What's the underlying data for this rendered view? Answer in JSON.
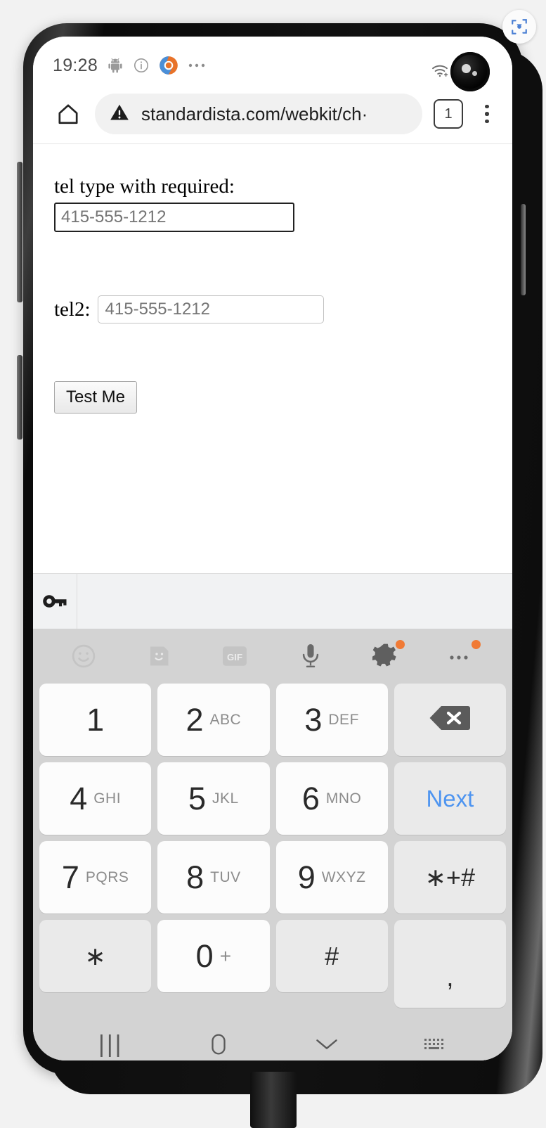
{
  "device": {
    "screenshot_badge_icon": "screenshot-scan-icon"
  },
  "status_bar": {
    "clock": "19:28",
    "left_icons": [
      "android-icon",
      "info-icon",
      "chrome-icon",
      "more-notifications-icon"
    ],
    "right_icons": [
      "wifi-icon",
      "signal-icon",
      "battery-icon"
    ],
    "camera": "front-camera-cutout"
  },
  "browser": {
    "home_icon": "home-icon",
    "security_icon": "warning-triangle-icon",
    "url": "standardista.com/webkit/ch·",
    "tab_count": "1",
    "menu_icon": "overflow-menu-icon"
  },
  "page": {
    "tel1": {
      "label": "tel type with required:",
      "value": "",
      "placeholder": "415-555-1212"
    },
    "tel2": {
      "label": "tel2:",
      "value": "",
      "placeholder": "415-555-1212"
    },
    "submit_label": "Test Me"
  },
  "autofill": {
    "key_icon": "password-key-icon"
  },
  "keyboard": {
    "toolbar": [
      {
        "name": "emoji-icon",
        "badge": false
      },
      {
        "name": "sticker-icon",
        "badge": false
      },
      {
        "name": "gif-icon",
        "badge": false,
        "label": "GIF"
      },
      {
        "name": "microphone-icon",
        "badge": false
      },
      {
        "name": "settings-gear-icon",
        "badge": true
      },
      {
        "name": "keyboard-more-icon",
        "badge": true
      }
    ],
    "badge_color": "#f07a35",
    "next_key_color": "#4d94f0",
    "rows": [
      [
        {
          "digit": "1",
          "letters": "",
          "style": "white",
          "name": "key-1"
        },
        {
          "digit": "2",
          "letters": "ABC",
          "style": "white",
          "name": "key-2"
        },
        {
          "digit": "3",
          "letters": "DEF",
          "style": "white",
          "name": "key-3"
        },
        {
          "digit": "",
          "letters": "",
          "style": "gray",
          "name": "key-backspace",
          "icon": "backspace-icon"
        }
      ],
      [
        {
          "digit": "4",
          "letters": "GHI",
          "style": "white",
          "name": "key-4"
        },
        {
          "digit": "5",
          "letters": "JKL",
          "style": "white",
          "name": "key-5"
        },
        {
          "digit": "6",
          "letters": "MNO",
          "style": "white",
          "name": "key-6"
        },
        {
          "digit": "",
          "letters": "",
          "style": "gray",
          "name": "key-next",
          "text": "Next"
        }
      ],
      [
        {
          "digit": "7",
          "letters": "PQRS",
          "style": "white",
          "name": "key-7"
        },
        {
          "digit": "8",
          "letters": "TUV",
          "style": "white",
          "name": "key-8"
        },
        {
          "digit": "9",
          "letters": "WXYZ",
          "style": "white",
          "name": "key-9"
        },
        {
          "digit": "",
          "letters": "",
          "style": "gray",
          "name": "key-symbols",
          "text": "∗+#"
        }
      ],
      [
        {
          "digit": "",
          "letters": "",
          "style": "gray",
          "name": "key-asterisk",
          "text": "∗"
        },
        {
          "digit": "0",
          "letters": "+",
          "style": "white",
          "name": "key-0"
        },
        {
          "digit": "",
          "letters": "",
          "style": "gray",
          "name": "key-hash",
          "text": "#"
        },
        {
          "digit": "",
          "letters": "",
          "style": "gray",
          "name": "key-comma",
          "text": ","
        }
      ]
    ]
  },
  "nav_bar": {
    "recents_label": "|||",
    "items": [
      "recents-icon",
      "home-icon",
      "hide-keyboard-icon",
      "switch-keyboard-icon"
    ]
  }
}
